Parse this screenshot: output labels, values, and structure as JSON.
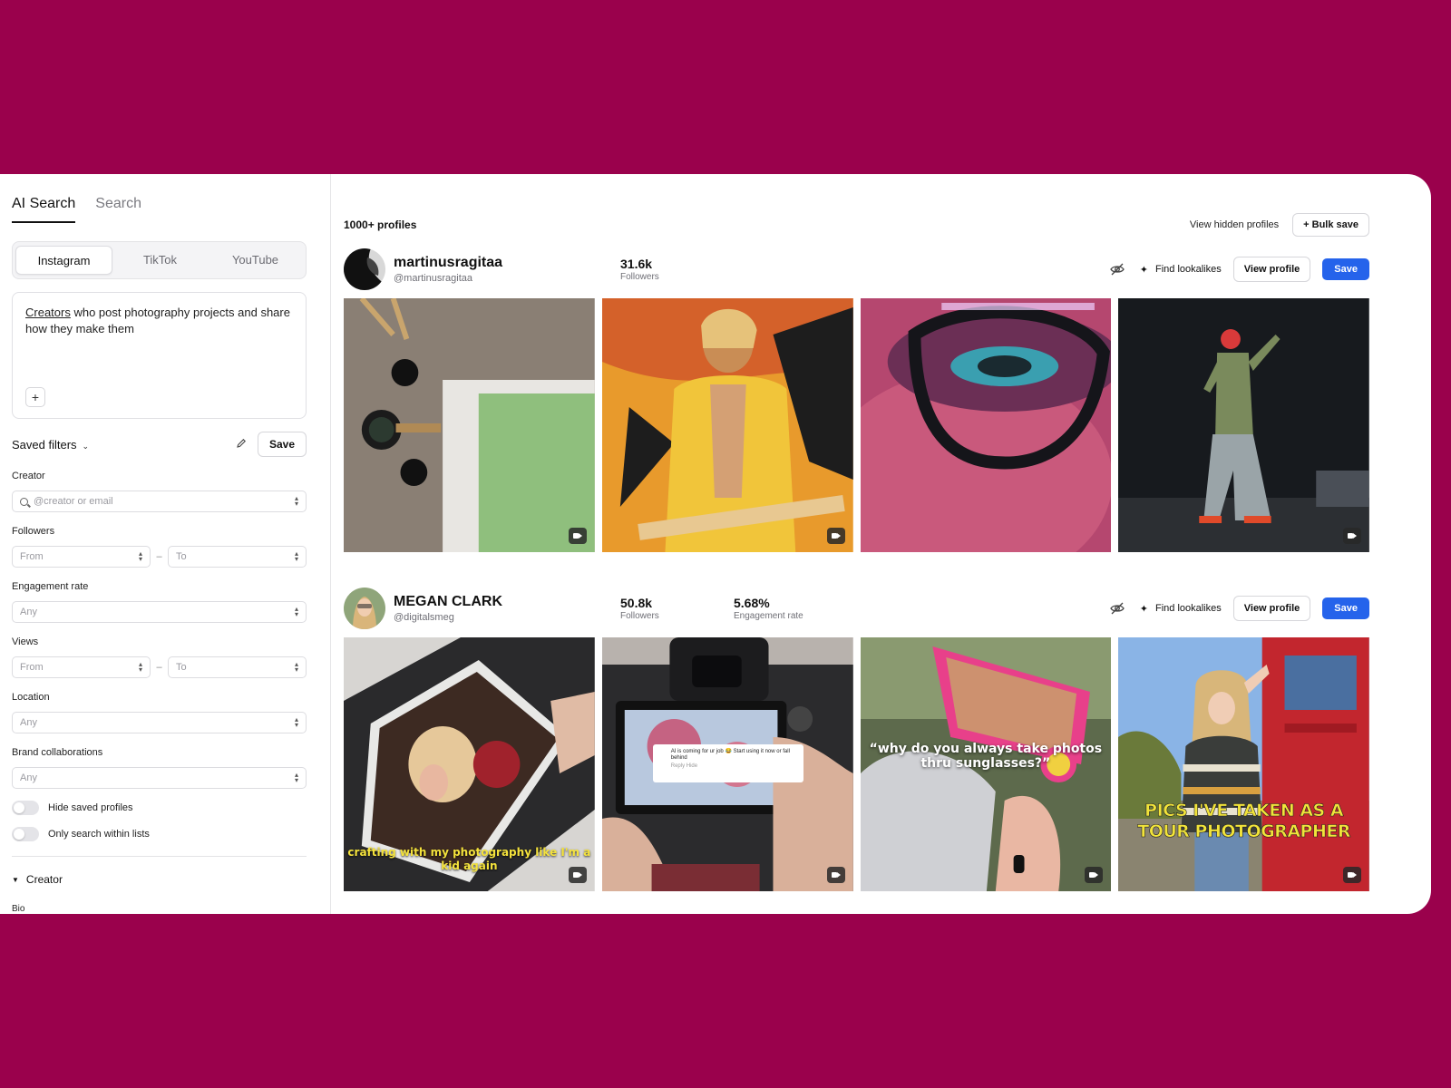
{
  "colors": {
    "background": "#9a014c",
    "accent": "#2563eb"
  },
  "sidebar": {
    "mode_tabs": [
      {
        "label": "AI Search",
        "active": true
      },
      {
        "label": "Search",
        "active": false
      }
    ],
    "platform_tabs": [
      {
        "label": "Instagram",
        "active": true
      },
      {
        "label": "TikTok",
        "active": false
      },
      {
        "label": "YouTube",
        "active": false
      }
    ],
    "prompt": {
      "highlight": "Creators",
      "rest": " who post photography projects and share how they make them",
      "add_button": "+"
    },
    "saved_filters": {
      "label": "Saved filters",
      "save_label": "Save",
      "edit_icon": "pencil-icon"
    },
    "filters": {
      "creator": {
        "label": "Creator",
        "placeholder": "@creator or email"
      },
      "followers": {
        "label": "Followers",
        "from": "From",
        "to": "To"
      },
      "engagement": {
        "label": "Engagement rate",
        "value": "Any"
      },
      "views": {
        "label": "Views",
        "from": "From",
        "to": "To"
      },
      "location": {
        "label": "Location",
        "value": "Any"
      },
      "brand": {
        "label": "Brand collaborations",
        "value": "Any"
      }
    },
    "toggles": {
      "hide_saved": "Hide saved profiles",
      "only_lists": "Only search within lists"
    },
    "section": {
      "title": "Creator",
      "sub": "Bio"
    }
  },
  "main": {
    "count": "1000+ profiles",
    "view_hidden": "View hidden profiles",
    "bulk_save": "+ Bulk save",
    "find_lookalikes": "Find lookalikes",
    "view_profile": "View profile",
    "save": "Save",
    "creators": [
      {
        "name": "martinusragitaa",
        "handle": "@martinusragitaa",
        "followers": "31.6k",
        "followers_label": "Followers"
      },
      {
        "name": "MEGAN CLARK",
        "handle": "@digitalsmeg",
        "followers": "50.8k",
        "followers_label": "Followers",
        "engagement": "5.68%",
        "engagement_label": "Engagement rate",
        "captions": {
          "c1": "crafting with my photography like I'm a kid again",
          "c2_comment": "AI is coming for ur job 😂 Start using it now or fall behind",
          "c2_meta": "Reply   Hide",
          "c3": "“why do you always take photos thru sunglasses?”",
          "c4": "PICS I'VE TAKEN AS A TOUR PHOTOGRAPHER"
        }
      }
    ]
  }
}
